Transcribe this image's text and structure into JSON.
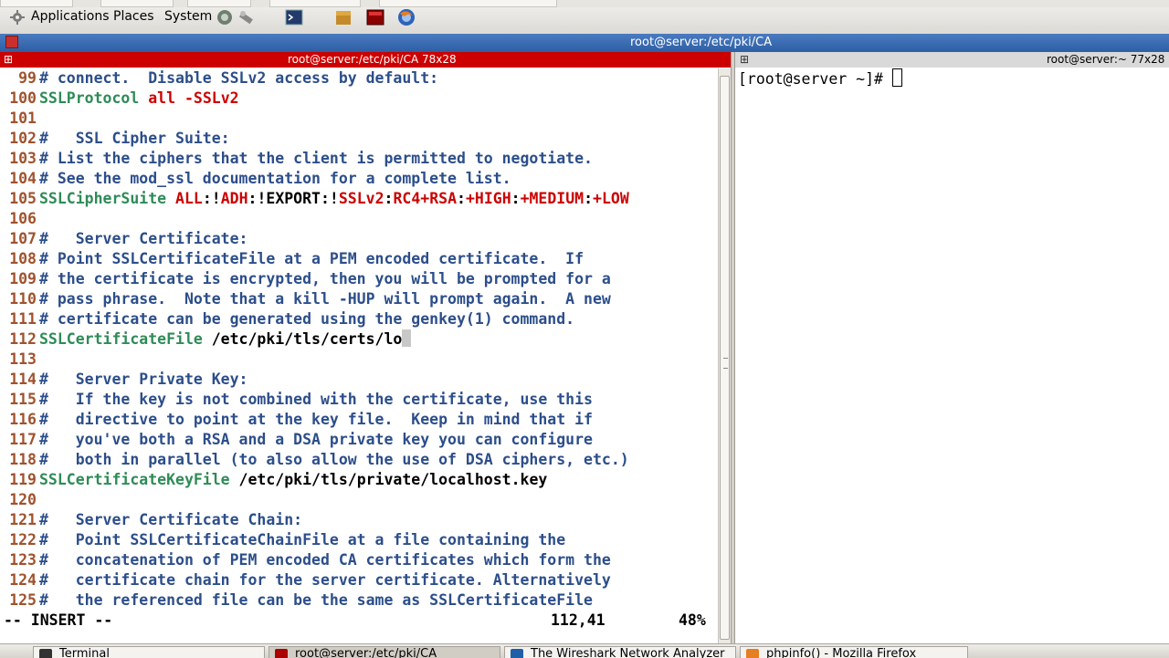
{
  "top_panel": {
    "menus": [
      "Applications",
      "Places",
      "System"
    ],
    "icons": [
      "applications-icon",
      "network-icon",
      "tools-icon",
      "terminal-launcher-icon",
      "package-icon",
      "red-terminal-icon",
      "firefox-icon"
    ]
  },
  "window": {
    "title": "root@server:/etc/pki/CA"
  },
  "left_pane": {
    "title": "root@server:/etc/pki/CA 78x28",
    "lines": [
      {
        "n": "99",
        "parts": [
          {
            "c": "cm",
            "t": "# connect.  Disable SSLv2 access by default:"
          }
        ]
      },
      {
        "n": "100",
        "parts": [
          {
            "c": "kw",
            "t": "SSLProtocol"
          },
          {
            "c": "bl",
            "t": " "
          },
          {
            "c": "red",
            "t": "all -SSLv2"
          }
        ]
      },
      {
        "n": "101",
        "parts": []
      },
      {
        "n": "102",
        "parts": [
          {
            "c": "cm",
            "t": "#   SSL Cipher Suite:"
          }
        ]
      },
      {
        "n": "103",
        "parts": [
          {
            "c": "cm",
            "t": "# List the ciphers that the client is permitted to negotiate."
          }
        ]
      },
      {
        "n": "104",
        "parts": [
          {
            "c": "cm",
            "t": "# See the mod_ssl documentation for a complete list."
          }
        ]
      },
      {
        "n": "105",
        "parts": [
          {
            "c": "kw",
            "t": "SSLCipherSuite"
          },
          {
            "c": "bl",
            "t": " "
          },
          {
            "c": "red",
            "t": "ALL"
          },
          {
            "c": "bl",
            "t": ":!"
          },
          {
            "c": "red",
            "t": "ADH"
          },
          {
            "c": "bl",
            "t": ":!EXPORT:!"
          },
          {
            "c": "red",
            "t": "SSLv2"
          },
          {
            "c": "bl",
            "t": ":"
          },
          {
            "c": "red",
            "t": "RC4+RSA"
          },
          {
            "c": "bl",
            "t": ":"
          },
          {
            "c": "red",
            "t": "+HIGH"
          },
          {
            "c": "bl",
            "t": ":"
          },
          {
            "c": "red",
            "t": "+MEDIUM"
          },
          {
            "c": "bl",
            "t": ":"
          },
          {
            "c": "red",
            "t": "+LOW"
          }
        ]
      },
      {
        "n": "106",
        "parts": []
      },
      {
        "n": "107",
        "parts": [
          {
            "c": "cm",
            "t": "#   Server Certificate:"
          }
        ]
      },
      {
        "n": "108",
        "parts": [
          {
            "c": "cm",
            "t": "# Point SSLCertificateFile at a PEM encoded certificate.  If"
          }
        ]
      },
      {
        "n": "109",
        "parts": [
          {
            "c": "cm",
            "t": "# the certificate is encrypted, then you will be prompted for a"
          }
        ]
      },
      {
        "n": "110",
        "parts": [
          {
            "c": "cm",
            "t": "# pass phrase.  Note that a kill -HUP will prompt again.  A new"
          }
        ]
      },
      {
        "n": "111",
        "parts": [
          {
            "c": "cm",
            "t": "# certificate can be generated using the genkey(1) command."
          }
        ]
      },
      {
        "n": "112",
        "parts": [
          {
            "c": "kw",
            "t": "SSLCertificateFile"
          },
          {
            "c": "bl",
            "t": " /etc/pki/tls/certs/lo"
          }
        ],
        "cursor": true
      },
      {
        "n": "113",
        "parts": []
      },
      {
        "n": "114",
        "parts": [
          {
            "c": "cm",
            "t": "#   Server Private Key:"
          }
        ]
      },
      {
        "n": "115",
        "parts": [
          {
            "c": "cm",
            "t": "#   If the key is not combined with the certificate, use this"
          }
        ]
      },
      {
        "n": "116",
        "parts": [
          {
            "c": "cm",
            "t": "#   directive to point at the key file.  Keep in mind that if"
          }
        ]
      },
      {
        "n": "117",
        "parts": [
          {
            "c": "cm",
            "t": "#   you've both a RSA and a DSA private key you can configure"
          }
        ]
      },
      {
        "n": "118",
        "parts": [
          {
            "c": "cm",
            "t": "#   both in parallel (to also allow the use of DSA ciphers, etc.)"
          }
        ]
      },
      {
        "n": "119",
        "parts": [
          {
            "c": "kw",
            "t": "SSLCertificateKeyFile"
          },
          {
            "c": "bl",
            "t": " /etc/pki/tls/private/localhost.key"
          }
        ]
      },
      {
        "n": "120",
        "parts": []
      },
      {
        "n": "121",
        "parts": [
          {
            "c": "cm",
            "t": "#   Server Certificate Chain:"
          }
        ]
      },
      {
        "n": "122",
        "parts": [
          {
            "c": "cm",
            "t": "#   Point SSLCertificateChainFile at a file containing the"
          }
        ]
      },
      {
        "n": "123",
        "parts": [
          {
            "c": "cm",
            "t": "#   concatenation of PEM encoded CA certificates which form the"
          }
        ]
      },
      {
        "n": "124",
        "parts": [
          {
            "c": "cm",
            "t": "#   certificate chain for the server certificate. Alternatively"
          }
        ]
      },
      {
        "n": "125",
        "parts": [
          {
            "c": "cm",
            "t": "#   the referenced file can be the same as SSLCertificateFile"
          }
        ]
      }
    ],
    "status": {
      "mode": "-- INSERT --",
      "position": "112,41",
      "percent": "48%"
    }
  },
  "right_pane": {
    "title": "root@server:~ 77x28",
    "prompt": "[root@server ~]# "
  },
  "taskbar": {
    "items": [
      {
        "label": "Terminal",
        "icon": "terminal-icon"
      },
      {
        "label": "root@server:/etc/pki/CA",
        "icon": "red-terminal-icon"
      },
      {
        "label": "The Wireshark Network Analyzer",
        "icon": "wireshark-icon"
      },
      {
        "label": "phpinfo() - Mozilla Firefox",
        "icon": "firefox-icon"
      }
    ]
  },
  "colors": {
    "comment": "#2c4e8a",
    "keyword": "#2e8b57",
    "value": "#cc0000",
    "line_number": "#a0522d",
    "active_titlebar": "#cc0000"
  }
}
